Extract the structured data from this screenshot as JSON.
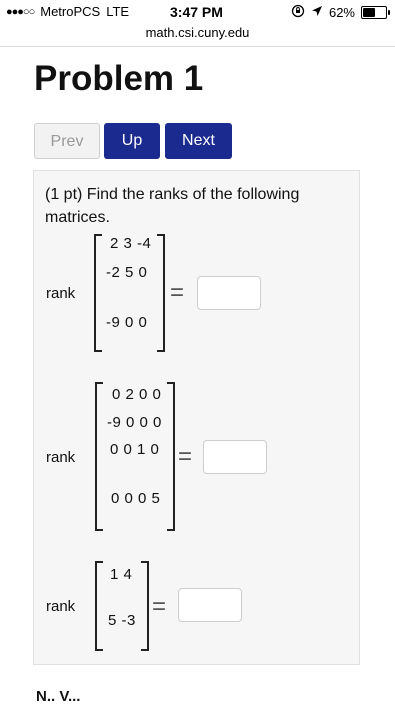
{
  "status_bar": {
    "signal_dots": "●●●○○",
    "carrier": "MetroPCS",
    "network": "LTE",
    "time": "3:47 PM",
    "battery_percent": "62%",
    "battery_level": 0.62,
    "icons": [
      "rotation-lock-icon",
      "location-arrow-icon",
      "battery-icon"
    ]
  },
  "browser": {
    "url": "math.csi.cuny.edu"
  },
  "page": {
    "title": "Problem 1",
    "nav": {
      "prev": "Prev",
      "up": "Up",
      "next": "Next"
    }
  },
  "problem": {
    "prompt": "(1 pt) Find the ranks of the following matrices.",
    "matrices": [
      {
        "label": "rank",
        "rows": [
          "2 3 -4",
          "-2 5 0",
          "-9 0 0"
        ]
      },
      {
        "label": "rank",
        "rows": [
          "0 2 0 0",
          "-9 0 0 0",
          "0 0 1 0",
          "0 0 0 5"
        ]
      },
      {
        "label": "rank",
        "rows": [
          "1 4",
          "5 -3"
        ]
      }
    ],
    "equals": "="
  },
  "footer": {
    "note_cutoff": "N.. V..."
  }
}
